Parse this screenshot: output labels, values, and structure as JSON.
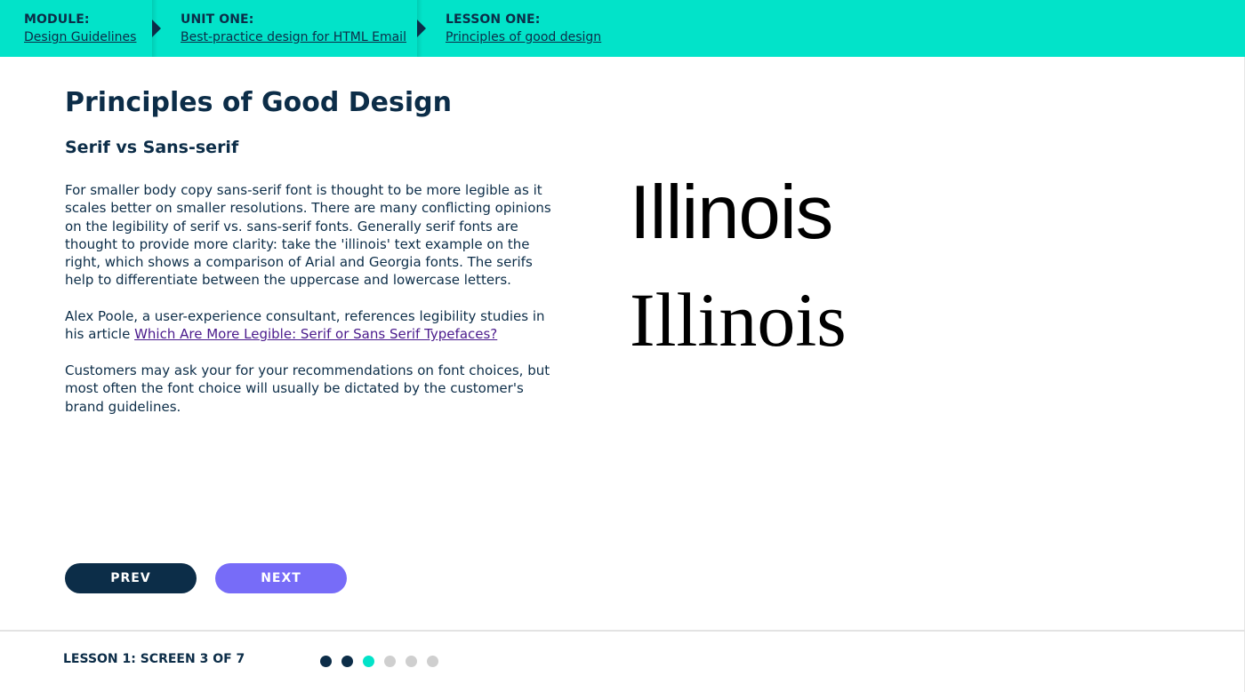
{
  "breadcrumbs": [
    {
      "kicker": "MODULE:",
      "link": "Design Guidelines"
    },
    {
      "kicker": "UNIT ONE:",
      "link": "Best-practice design for HTML Email"
    },
    {
      "kicker": "LESSON ONE:",
      "link": "Principles of good design"
    }
  ],
  "content": {
    "title": "Principles of Good Design",
    "subtitle": "Serif vs Sans-serif",
    "paragraph1": "For smaller body copy sans-serif font is thought to be more legible as it scales better on smaller resolutions. There are many conflicting opinions on the legibility of serif vs. sans-serif fonts. Generally serif fonts are thought to provide more clarity: take the 'illinois' text example on the right, which shows a comparison of Arial and Georgia fonts. The serifs help to differentiate between the uppercase and lowercase letters.",
    "paragraph2_prefix": "Alex Poole, a user-experience consultant, references legibility studies in his article ",
    "paragraph2_link": "Which Are More Legible: Serif or Sans Serif Typefaces?",
    "paragraph3": "Customers may ask your for your recommendations on font choices, but most often the font choice will usually be dictated by the customer's brand guidelines."
  },
  "samples": {
    "sans": "Illinois",
    "serif": "Illinois"
  },
  "navigation": {
    "prev_label": "PREV",
    "next_label": "NEXT"
  },
  "footer": {
    "progress_label": "LESSON 1: SCREEN 3 OF 7",
    "current_screen": 3,
    "total_screens": 7
  },
  "colors": {
    "accent": "#02e3c9",
    "navy": "#0c2d48",
    "next_button": "#776cf8",
    "dot_inactive": "#cfcfcf"
  }
}
